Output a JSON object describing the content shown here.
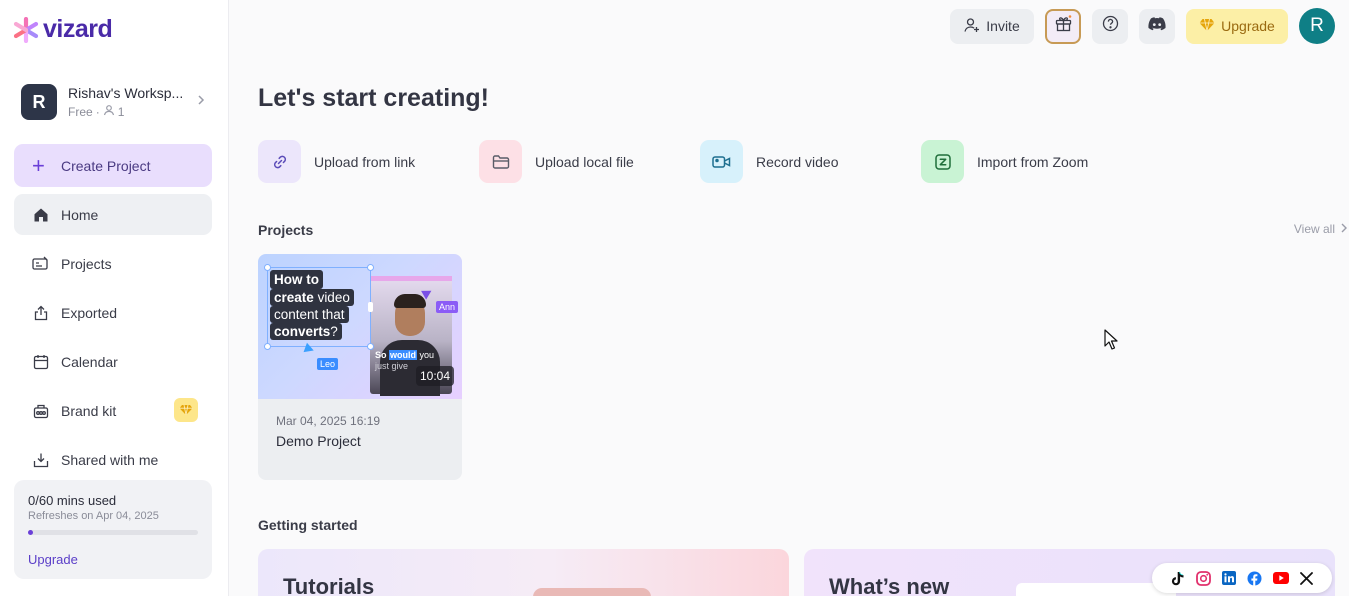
{
  "app": {
    "brand": "vizard"
  },
  "workspace": {
    "initial": "R",
    "name": "Rishav's Worksp...",
    "plan": "Free",
    "members": "1"
  },
  "sidebar": {
    "create_label": "Create Project",
    "items": [
      {
        "label": "Home",
        "icon": "home-icon",
        "active": true
      },
      {
        "label": "Projects",
        "icon": "projects-icon"
      },
      {
        "label": "Exported",
        "icon": "export-icon"
      },
      {
        "label": "Calendar",
        "icon": "calendar-icon"
      },
      {
        "label": "Brand kit",
        "icon": "brand-kit-icon",
        "pro": true
      },
      {
        "label": "Shared with me",
        "icon": "shared-icon"
      }
    ],
    "usage": {
      "used": "0/60 mins used",
      "refresh": "Refreshes on Apr 04, 2025",
      "progress": 0.02,
      "upgrade_label": "Upgrade"
    }
  },
  "topbar": {
    "invite_label": "Invite",
    "upgrade_label": "Upgrade",
    "avatar_initial": "R"
  },
  "main": {
    "heading": "Let's start creating!",
    "quick_actions": [
      {
        "label": "Upload from link",
        "icon": "link-icon",
        "bg": "#ece6fb"
      },
      {
        "label": "Upload local file",
        "icon": "folder-icon",
        "bg": "#fde0e6"
      },
      {
        "label": "Record video",
        "icon": "video-camera-icon",
        "bg": "#d7f1fb"
      },
      {
        "label": "Import from Zoom",
        "icon": "zoom-icon",
        "bg": "#c9f3d4"
      }
    ],
    "projects_title": "Projects",
    "view_all": "View all",
    "projects": [
      {
        "date": "Mar 04, 2025 16:19",
        "name": "Demo Project",
        "duration": "10:04",
        "thumb": {
          "line1": "How to",
          "line2a": "create",
          "line2b": "video",
          "line3": "content that",
          "line4": "converts",
          "line4q": "?",
          "tag_ann": "Ann",
          "tag_leo": "Leo",
          "caption_a": "So",
          "caption_b": "would",
          "caption_c": "you",
          "caption_d": "just give"
        }
      }
    ],
    "getting_started_title": "Getting started",
    "getting_started": [
      {
        "title": "Tutorials"
      },
      {
        "title": "What’s new"
      }
    ]
  },
  "social": [
    "tiktok-icon",
    "instagram-icon",
    "linkedin-icon",
    "facebook-icon",
    "youtube-icon",
    "x-icon"
  ],
  "colors": {
    "accent": "#6a3fd8",
    "brand": "#4a2aa8",
    "upgrade_bg": "#fcefa6",
    "avatar": "#0f7f86"
  }
}
